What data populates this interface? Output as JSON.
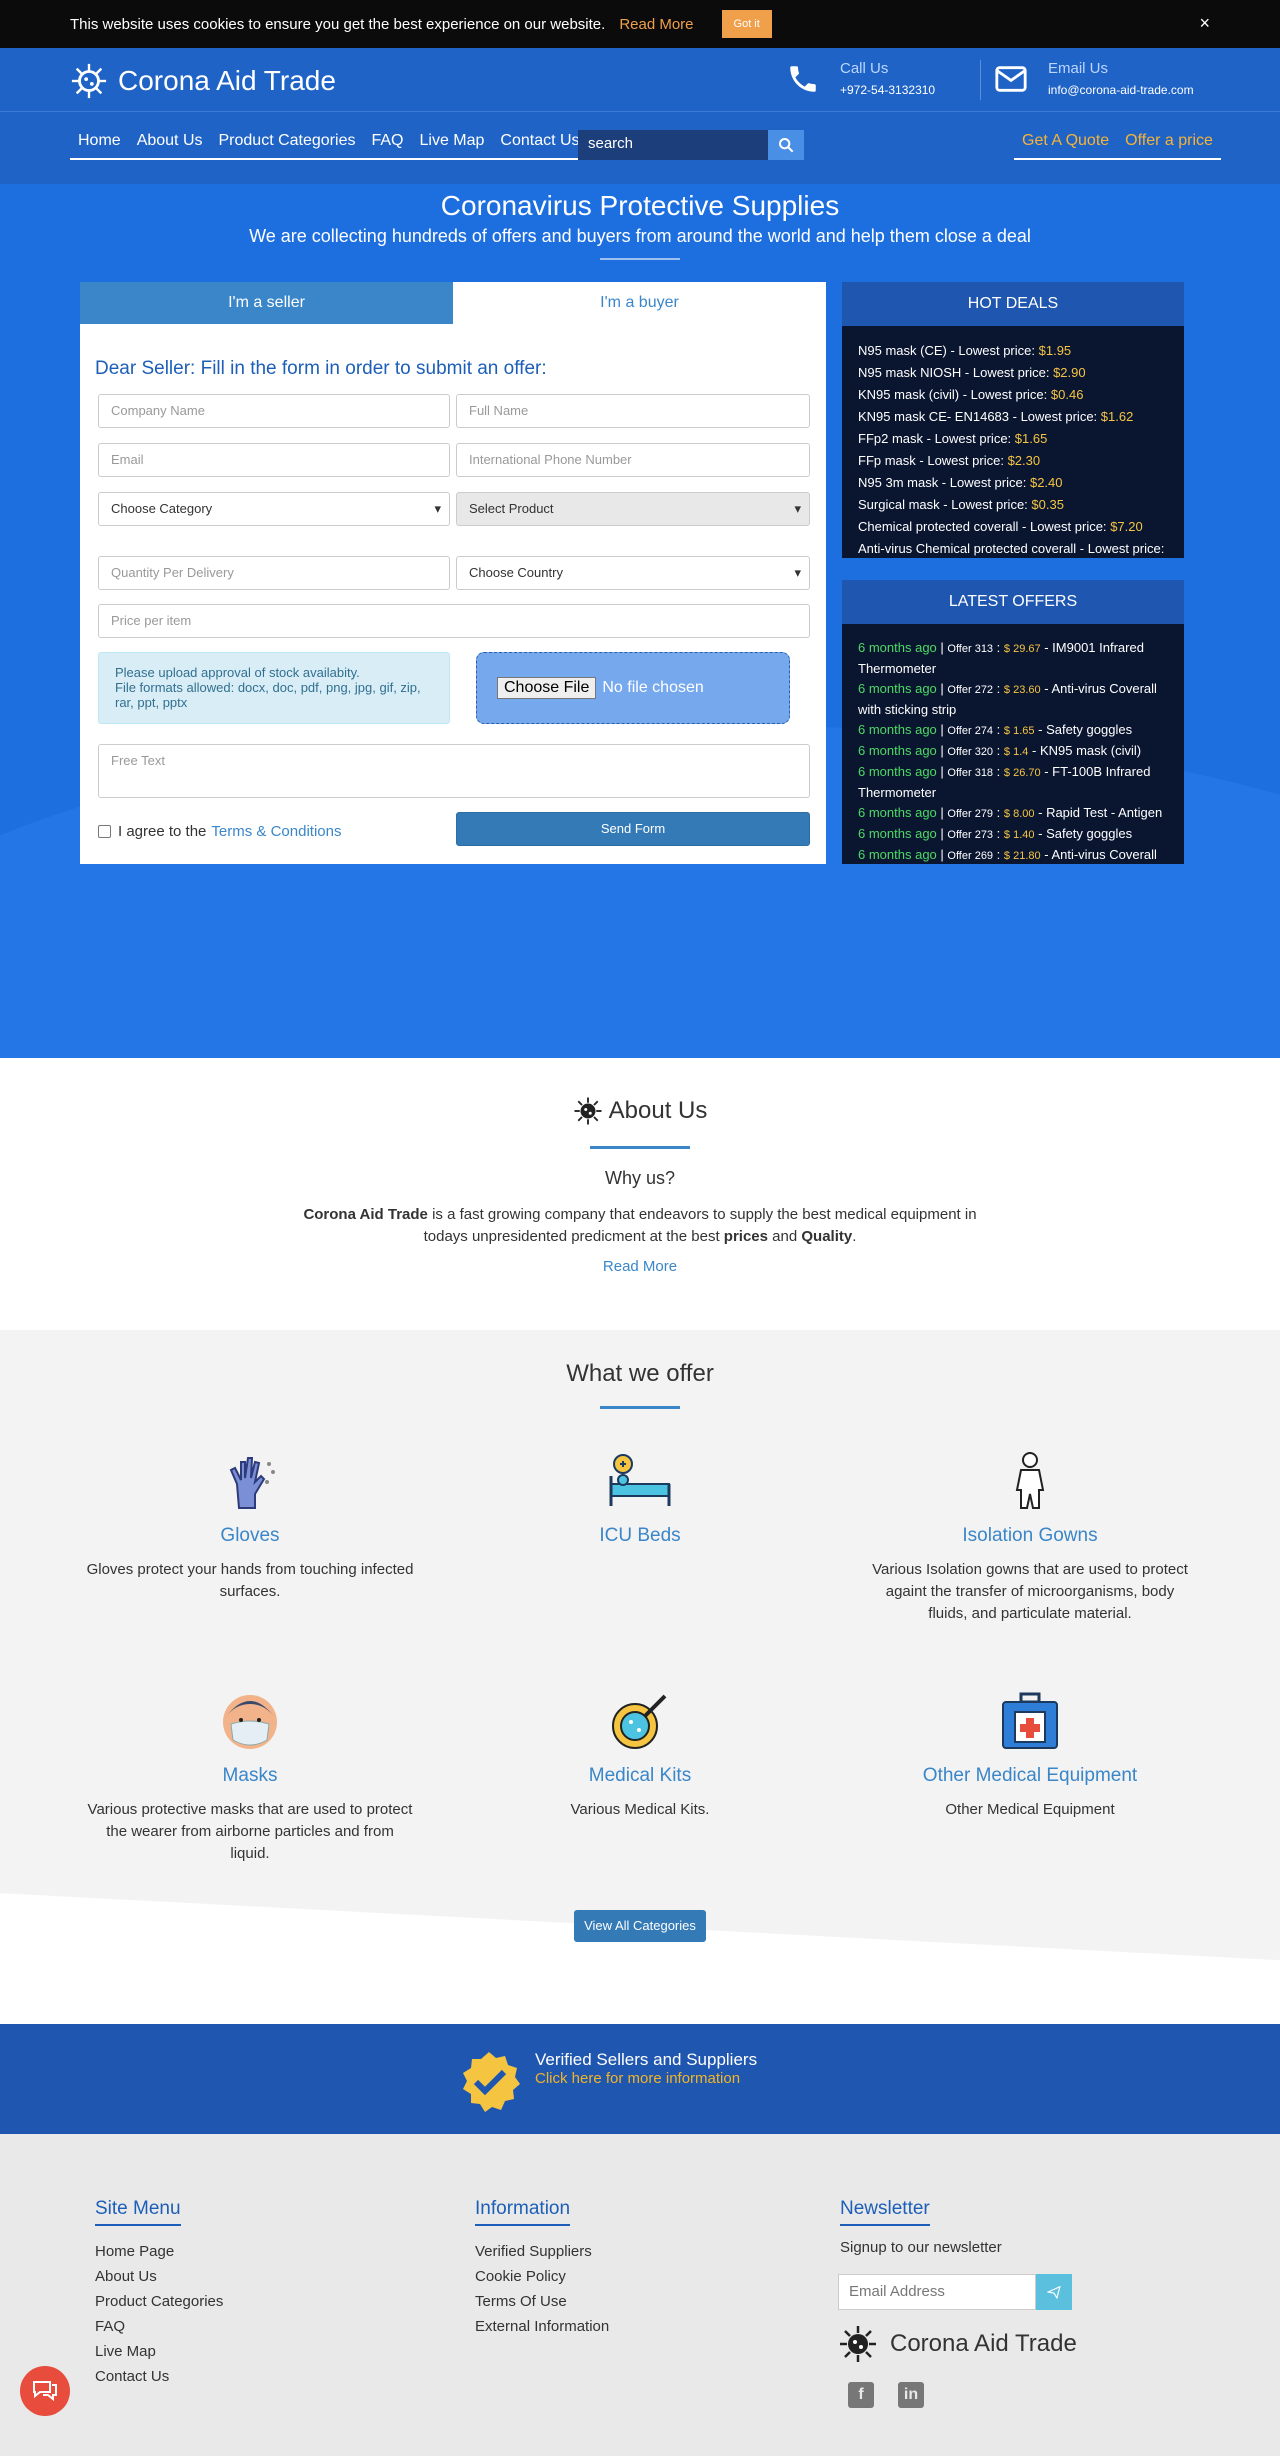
{
  "cookie": {
    "text": "This website uses cookies to ensure you get the best experience on our website.",
    "read_more": "Read More",
    "got_it": "Got it",
    "close": "×"
  },
  "header": {
    "brand": "Corona Aid Trade",
    "call_label": "Call Us",
    "call_value": "+972-54-3132310",
    "email_label": "Email Us",
    "email_value": "info@corona-aid-trade.com"
  },
  "nav": {
    "items": [
      "Home",
      "About Us",
      "Product Categories",
      "FAQ",
      "Live Map",
      "Contact Us"
    ],
    "search_value": "search",
    "get_quote": "Get A Quote",
    "offer_price": "Offer a price"
  },
  "hero": {
    "title": "Coronavirus Protective Supplies",
    "subtitle": "We are collecting hundreds of offers and buyers from around the world and help them close a deal"
  },
  "form": {
    "tab_seller": "I'm a seller",
    "tab_buyer": "I'm a buyer",
    "title": "Dear Seller: Fill in the form in order to submit an offer:",
    "company": "Company Name",
    "fullname": "Full Name",
    "email": "Email",
    "phone": "International Phone Number",
    "category": "Choose Category",
    "product": "Select Product",
    "quantity": "Quantity Per Delivery",
    "country": "Choose Country",
    "price": "Price per item",
    "upload_line1": "Please upload approval of stock availabity.",
    "upload_line2": "File formats allowed: docx, doc, pdf, png, jpg, gif, zip, rar, ppt, pptx",
    "choose_file": "Choose File",
    "no_file": "No file chosen",
    "free_text": "Free Text",
    "agree": "I agree to the",
    "terms": "Terms & Conditions",
    "send": "Send Form"
  },
  "hot_deals": {
    "title": "HOT DEALS",
    "items": [
      {
        "name": "N95 mask (CE) - Lowest price:",
        "price": "$1.95"
      },
      {
        "name": "N95 mask NIOSH - Lowest price:",
        "price": "$2.90"
      },
      {
        "name": "KN95 mask (civil) - Lowest price:",
        "price": "$0.46"
      },
      {
        "name": "KN95 mask CE- EN14683 - Lowest price:",
        "price": "$1.62"
      },
      {
        "name": "FFp2 mask - Lowest price:",
        "price": "$1.65"
      },
      {
        "name": "FFp mask - Lowest price:",
        "price": "$2.30"
      },
      {
        "name": "N95 3m mask - Lowest price:",
        "price": "$2.40"
      },
      {
        "name": "Surgical mask - Lowest price:",
        "price": "$0.35"
      },
      {
        "name": "Chemical protected coverall - Lowest price:",
        "price": "$7.20"
      },
      {
        "name": "Anti-virus Chemical protected coverall - Lowest price:",
        "price": ""
      }
    ]
  },
  "latest_offers": {
    "title": "LATEST OFFERS",
    "items": [
      {
        "ago": "6 months ago",
        "offer": "Offer 313",
        "price": "$ 29.67",
        "name": "IM9001 Infrared Thermometer"
      },
      {
        "ago": "6 months ago",
        "offer": "Offer 272",
        "price": "$ 23.60",
        "name": "Anti-virus Coverall with sticking strip"
      },
      {
        "ago": "6 months ago",
        "offer": "Offer 274",
        "price": "$ 1.65",
        "name": "Safety goggles"
      },
      {
        "ago": "6 months ago",
        "offer": "Offer 320",
        "price": "$ 1.4",
        "name": "KN95 mask (civil)"
      },
      {
        "ago": "6 months ago",
        "offer": "Offer 318",
        "price": "$ 26.70",
        "name": "FT-100B Infrared Thermometer"
      },
      {
        "ago": "6 months ago",
        "offer": "Offer 279",
        "price": "$ 8.00",
        "name": "Rapid Test - Antigen"
      },
      {
        "ago": "6 months ago",
        "offer": "Offer 273",
        "price": "$ 1.40",
        "name": "Safety goggles"
      },
      {
        "ago": "6 months ago",
        "offer": "Offer 269",
        "price": "$ 21.80",
        "name": "Anti-virus Coverall with"
      }
    ]
  },
  "about": {
    "title": "About Us",
    "why": "Why us?",
    "brand": "Corona Aid Trade",
    "text1": " is a fast growing company that endeavors to supply the best medical equipment in todays unpresidented predicment at the best ",
    "prices": "prices",
    "and": " and ",
    "quality": "Quality",
    "dot": ".",
    "read_more": "Read More"
  },
  "offers": {
    "title": "What we offer",
    "items": [
      {
        "title": "Gloves",
        "desc": "Gloves protect your hands from touching infected surfaces.",
        "icon": "gloves-icon"
      },
      {
        "title": "ICU Beds",
        "desc": "",
        "icon": "icu-bed-icon"
      },
      {
        "title": "Isolation Gowns",
        "desc": "Various Isolation gowns that are used to protect againt the transfer of microorganisms, body fluids, and particulate material.",
        "icon": "gown-icon"
      },
      {
        "title": "Masks",
        "desc": "Various protective masks that are used to protect the wearer from airborne particles and from liquid.",
        "icon": "mask-icon"
      },
      {
        "title": "Medical Kits",
        "desc": "Various Medical Kits.",
        "icon": "medical-kit-icon"
      },
      {
        "title": "Other Medical Equipment",
        "desc": "Other Medical Equipment",
        "icon": "first-aid-box-icon"
      }
    ],
    "view_all": "View All Categories"
  },
  "verified": {
    "title": "Verified Sellers and Suppliers",
    "link": "Click here for more information"
  },
  "footer": {
    "site_menu_title": "Site Menu",
    "site_menu": [
      "Home Page",
      "About Us",
      "Product Categories",
      "FAQ",
      "Live Map",
      "Contact Us"
    ],
    "info_title": "Information",
    "info": [
      "Verified Suppliers",
      "Cookie Policy",
      "Terms Of Use",
      "External Information"
    ],
    "newsletter_title": "Newsletter",
    "newsletter_text": "Signup to our newsletter",
    "email_placeholder": "Email Address",
    "brand": "Corona Aid Trade"
  },
  "colors": {
    "primary": "#1f63c6",
    "hero": "#1d6fe0",
    "accent": "#f0a04b",
    "link": "#3a86c9"
  }
}
